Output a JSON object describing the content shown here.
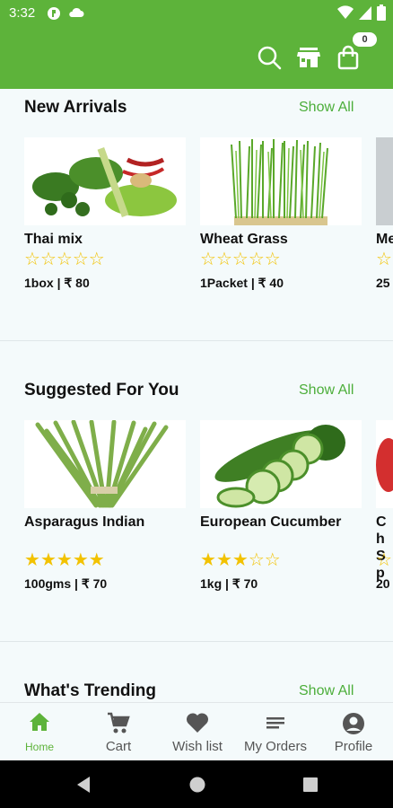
{
  "status_bar": {
    "time": "3:32"
  },
  "app_bar": {
    "cart_count": "0"
  },
  "sections": [
    {
      "title": "New Arrivals",
      "show_all": "Show All",
      "products": [
        {
          "name": "Thai mix",
          "rating": 0,
          "price": "1box | ₹ 80"
        },
        {
          "name": "Wheat Grass",
          "rating": 0,
          "price": "1Packet | ₹ 40"
        },
        {
          "name": "Me",
          "rating": 0,
          "price": "25"
        }
      ]
    },
    {
      "title": "Suggested For You",
      "show_all": "Show All",
      "products": [
        {
          "name": "Asparagus Indian",
          "rating": 5,
          "price": "100gms | ₹ 70"
        },
        {
          "name": "European Cucumber",
          "rating": 3,
          "price": "1kg | ₹ 70"
        },
        {
          "name": "Ch Sp",
          "rating": 0,
          "price": "20"
        }
      ]
    },
    {
      "title": "What's Trending",
      "show_all": "Show All"
    }
  ],
  "bottom_nav": {
    "items": [
      {
        "label": "Home",
        "icon": "home-icon",
        "active": true
      },
      {
        "label": "Cart",
        "icon": "cart-icon"
      },
      {
        "label": "Wish list",
        "icon": "heart-icon"
      },
      {
        "label": "My Orders",
        "icon": "orders-icon"
      },
      {
        "label": "Profile",
        "icon": "profile-icon"
      }
    ]
  },
  "colors": {
    "brand_green": "#5db33a",
    "star_yellow": "#f2c200",
    "link_green": "#4cae3a"
  }
}
